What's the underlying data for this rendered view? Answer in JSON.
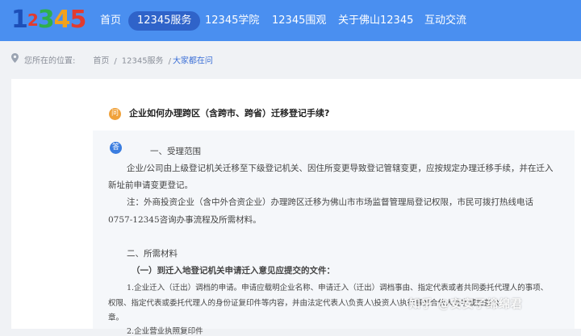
{
  "logo": {
    "text": "12345"
  },
  "nav": {
    "items": [
      {
        "label": "首页",
        "active": false
      },
      {
        "label": "12345服务",
        "active": true
      },
      {
        "label": "12345学院",
        "active": false
      },
      {
        "label": "12345围观",
        "active": false
      },
      {
        "label": "关于佛山12345",
        "active": false
      },
      {
        "label": "互动交流",
        "active": false
      }
    ]
  },
  "breadcrumb": {
    "prefix": "您所在的位置:",
    "items": [
      "首页",
      "12345服务",
      "大家都在问"
    ],
    "separator": "/"
  },
  "question": {
    "badge": "问",
    "text": "企业如何办理跨区（含跨市、跨省）迁移登记手续?"
  },
  "answer": {
    "badge": "答",
    "lines": [
      "一、受理范围",
      "企业/公司由上级登记机关迁移至下级登记机关、因住所变更导致登记管辖变更，应按规定办理迁移手续，并在迁入",
      "新址前申请变更登记。",
      "注：外商投资企业（含中外合资企业）办理跨区迁移为佛山市市场监督管理局登记权限，市民可拨打热线电话",
      "0757-12345咨询办事流程及所需材料。",
      "二、所需材料",
      "（一）到迁入地登记机关申请迁入意见应提交的文件：",
      "1.企业迁入（迁出）调档的申请。申请应载明企业名称、申请迁入（迁出）调档事由、指定代表或者共同委托代理人的事项、",
      "权限、指定代表或委托代理人的身份证复印件等内容，并由法定代表人\\负责人\\投资人\\执行事务合伙人签字或加盖公",
      "章。",
      "2.企业营业执照复印件"
    ]
  },
  "watermark": "知乎 @安安子绵绵君",
  "colors": {
    "nav_bg": "#4a8ff0",
    "nav_active": "#2f63c9",
    "accent": "#3a7de0",
    "question_badge": "#f0a13a"
  }
}
